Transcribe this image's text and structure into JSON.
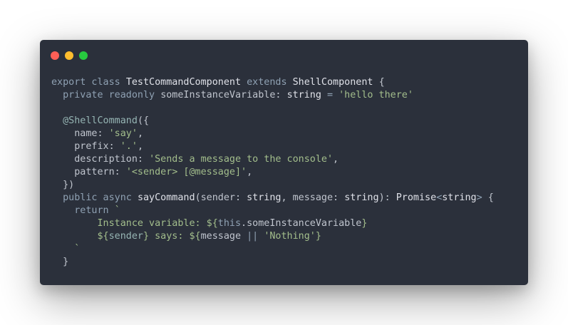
{
  "window": {
    "controls": [
      {
        "name": "close",
        "color": "#ff5f56"
      },
      {
        "name": "minimize",
        "color": "#ffbd2e"
      },
      {
        "name": "maximize",
        "color": "#27c93f"
      }
    ]
  },
  "code": {
    "language": "typescript",
    "lines": [
      [
        {
          "t": "export class ",
          "c": "kw"
        },
        {
          "t": "TestCommandComponent ",
          "c": "cls"
        },
        {
          "t": "extends ",
          "c": "kw"
        },
        {
          "t": "ShellComponent ",
          "c": "cls"
        },
        {
          "t": "{",
          "c": "var"
        }
      ],
      [
        {
          "t": "  private readonly ",
          "c": "kw"
        },
        {
          "t": "someInstanceVariable: ",
          "c": "var"
        },
        {
          "t": "string ",
          "c": "cls"
        },
        {
          "t": "= ",
          "c": "op"
        },
        {
          "t": "'hello there'",
          "c": "str"
        }
      ],
      [],
      [
        {
          "t": "  @ShellCommand",
          "c": "dec"
        },
        {
          "t": "({",
          "c": "var"
        }
      ],
      [
        {
          "t": "    name: ",
          "c": "var"
        },
        {
          "t": "'say'",
          "c": "str"
        },
        {
          "t": ",",
          "c": "var"
        }
      ],
      [
        {
          "t": "    prefix: ",
          "c": "var"
        },
        {
          "t": "'.'",
          "c": "str"
        },
        {
          "t": ",",
          "c": "var"
        }
      ],
      [
        {
          "t": "    description: ",
          "c": "var"
        },
        {
          "t": "'Sends a message to the console'",
          "c": "str"
        },
        {
          "t": ",",
          "c": "var"
        }
      ],
      [
        {
          "t": "    pattern: ",
          "c": "var"
        },
        {
          "t": "'<sender> [@message]'",
          "c": "str"
        },
        {
          "t": ",",
          "c": "var"
        }
      ],
      [
        {
          "t": "  })",
          "c": "var"
        }
      ],
      [
        {
          "t": "  public async ",
          "c": "kw"
        },
        {
          "t": "sayCommand",
          "c": "fn"
        },
        {
          "t": "(sender: ",
          "c": "var"
        },
        {
          "t": "string",
          "c": "cls"
        },
        {
          "t": ", message: ",
          "c": "var"
        },
        {
          "t": "string",
          "c": "cls"
        },
        {
          "t": "): ",
          "c": "var"
        },
        {
          "t": "Promise",
          "c": "cls"
        },
        {
          "t": "<",
          "c": "op"
        },
        {
          "t": "string",
          "c": "cls"
        },
        {
          "t": "> ",
          "c": "op"
        },
        {
          "t": "{",
          "c": "var"
        }
      ],
      [
        {
          "t": "    return ",
          "c": "kw"
        },
        {
          "t": "`",
          "c": "str"
        }
      ],
      [
        {
          "t": "        Instance variable: ",
          "c": "str"
        },
        {
          "t": "${",
          "c": "str"
        },
        {
          "t": "this",
          "c": "kw"
        },
        {
          "t": ".someInstanceVariable",
          "c": "var"
        },
        {
          "t": "}",
          "c": "str"
        }
      ],
      [
        {
          "t": "        ${",
          "c": "str"
        },
        {
          "t": "sender",
          "c": "tag"
        },
        {
          "t": "} says: ${",
          "c": "str"
        },
        {
          "t": "message ",
          "c": "var"
        },
        {
          "t": "|| ",
          "c": "op"
        },
        {
          "t": "'Nothing'",
          "c": "str"
        },
        {
          "t": "}",
          "c": "str"
        }
      ],
      [
        {
          "t": "    `",
          "c": "str"
        }
      ],
      [
        {
          "t": "  }",
          "c": "var"
        }
      ]
    ]
  }
}
